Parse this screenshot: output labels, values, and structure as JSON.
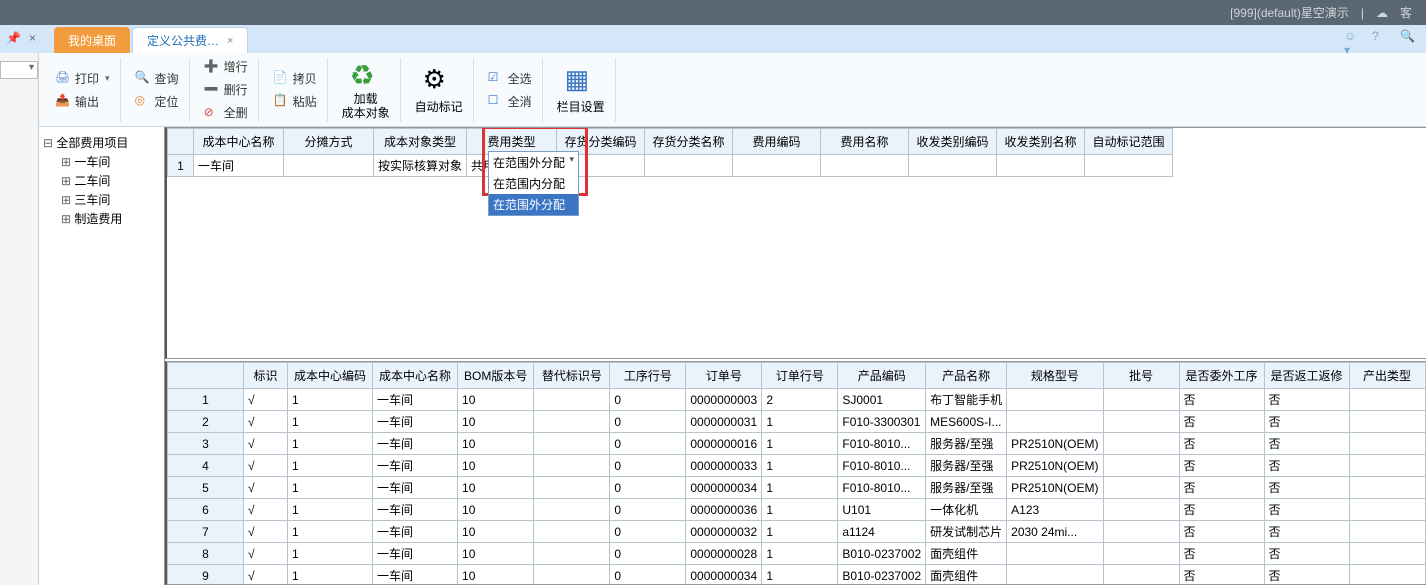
{
  "header": {
    "env_label": "[999](default)星空演示",
    "svc_label": "客"
  },
  "tabs": {
    "pin_icon": "pin",
    "close_icon": "×",
    "tab1": "我的桌面",
    "tab2": "定义公共费…",
    "tab2_close": "×"
  },
  "toolbar": {
    "print": "打印",
    "export": "输出",
    "query": "查询",
    "locate": "定位",
    "addrow": "增行",
    "delrow": "删行",
    "delall": "全删",
    "copy": "拷贝",
    "paste": "粘贴",
    "load_cost_obj": "加载\n成本对象",
    "auto_mark": "自动标记",
    "select_all": "全选",
    "deselect_all": "全消",
    "column_settings": "栏目设置"
  },
  "tree": {
    "root": "全部费用项目",
    "n1": "一车间",
    "n2": "二车间",
    "n3": "三车间",
    "n4": "制造费用"
  },
  "upper_table": {
    "headers": [
      "",
      "成本中心名称",
      "分摊方式",
      "成本对象类型",
      "费用类型",
      "存货分类编码",
      "存货分类名称",
      "费用编码",
      "费用名称",
      "收发类别编码",
      "收发类别名称",
      "自动标记范围"
    ],
    "row1_num": "1",
    "row1_center": "一车间",
    "row1_objtype": "按实际核算对象",
    "row1_feetype": "共用材料"
  },
  "dropdown": {
    "selected": "在范围外分配",
    "opt1": "在范围内分配",
    "opt2": "在范围外分配"
  },
  "lower_table": {
    "headers": [
      "",
      "标识",
      "成本中心编码",
      "成本中心名称",
      "BOM版本号",
      "替代标识号",
      "工序行号",
      "订单号",
      "订单行号",
      "产品编码",
      "产品名称",
      "规格型号",
      "批号",
      "是否委外工序",
      "是否返工返修",
      "产出类型"
    ],
    "rows": [
      {
        "n": "1",
        "mark": "√",
        "ccode": "1",
        "cname": "一车间",
        "bom": "10",
        "alt": "",
        "proc": "0",
        "ord": "0000000003",
        "ordl": "2",
        "pcode": "SJ0001",
        "pname": "布丁智能手机",
        "spec": "",
        "batch": "",
        "ow": "否",
        "rw": "否",
        "out": ""
      },
      {
        "n": "2",
        "mark": "√",
        "ccode": "1",
        "cname": "一车间",
        "bom": "10",
        "alt": "",
        "proc": "0",
        "ord": "0000000031",
        "ordl": "1",
        "pcode": "F010-3300301",
        "pname": "MES600S-I...",
        "spec": "",
        "batch": "",
        "ow": "否",
        "rw": "否",
        "out": ""
      },
      {
        "n": "3",
        "mark": "√",
        "ccode": "1",
        "cname": "一车间",
        "bom": "10",
        "alt": "",
        "proc": "0",
        "ord": "0000000016",
        "ordl": "1",
        "pcode": "F010-8010...",
        "pname": "服务器/至强",
        "spec": "PR2510N(OEM)",
        "batch": "",
        "ow": "否",
        "rw": "否",
        "out": ""
      },
      {
        "n": "4",
        "mark": "√",
        "ccode": "1",
        "cname": "一车间",
        "bom": "10",
        "alt": "",
        "proc": "0",
        "ord": "0000000033",
        "ordl": "1",
        "pcode": "F010-8010...",
        "pname": "服务器/至强",
        "spec": "PR2510N(OEM)",
        "batch": "",
        "ow": "否",
        "rw": "否",
        "out": ""
      },
      {
        "n": "5",
        "mark": "√",
        "ccode": "1",
        "cname": "一车间",
        "bom": "10",
        "alt": "",
        "proc": "0",
        "ord": "0000000034",
        "ordl": "1",
        "pcode": "F010-8010...",
        "pname": "服务器/至强",
        "spec": "PR2510N(OEM)",
        "batch": "",
        "ow": "否",
        "rw": "否",
        "out": ""
      },
      {
        "n": "6",
        "mark": "√",
        "ccode": "1",
        "cname": "一车间",
        "bom": "10",
        "alt": "",
        "proc": "0",
        "ord": "0000000036",
        "ordl": "1",
        "pcode": "U101",
        "pname": "一体化机",
        "spec": "A123",
        "batch": "",
        "ow": "否",
        "rw": "否",
        "out": ""
      },
      {
        "n": "7",
        "mark": "√",
        "ccode": "1",
        "cname": "一车间",
        "bom": "10",
        "alt": "",
        "proc": "0",
        "ord": "0000000032",
        "ordl": "1",
        "pcode": "a1124",
        "pname": "研发试制芯片",
        "spec": "2030 24mi...",
        "batch": "",
        "ow": "否",
        "rw": "否",
        "out": ""
      },
      {
        "n": "8",
        "mark": "√",
        "ccode": "1",
        "cname": "一车间",
        "bom": "10",
        "alt": "",
        "proc": "0",
        "ord": "0000000028",
        "ordl": "1",
        "pcode": "B010-0237002",
        "pname": "面壳组件",
        "spec": "",
        "batch": "",
        "ow": "否",
        "rw": "否",
        "out": ""
      },
      {
        "n": "9",
        "mark": "√",
        "ccode": "1",
        "cname": "一车间",
        "bom": "10",
        "alt": "",
        "proc": "0",
        "ord": "0000000034",
        "ordl": "1",
        "pcode": "B010-0237002",
        "pname": "面壳组件",
        "spec": "",
        "batch": "",
        "ow": "否",
        "rw": "否",
        "out": ""
      }
    ]
  }
}
